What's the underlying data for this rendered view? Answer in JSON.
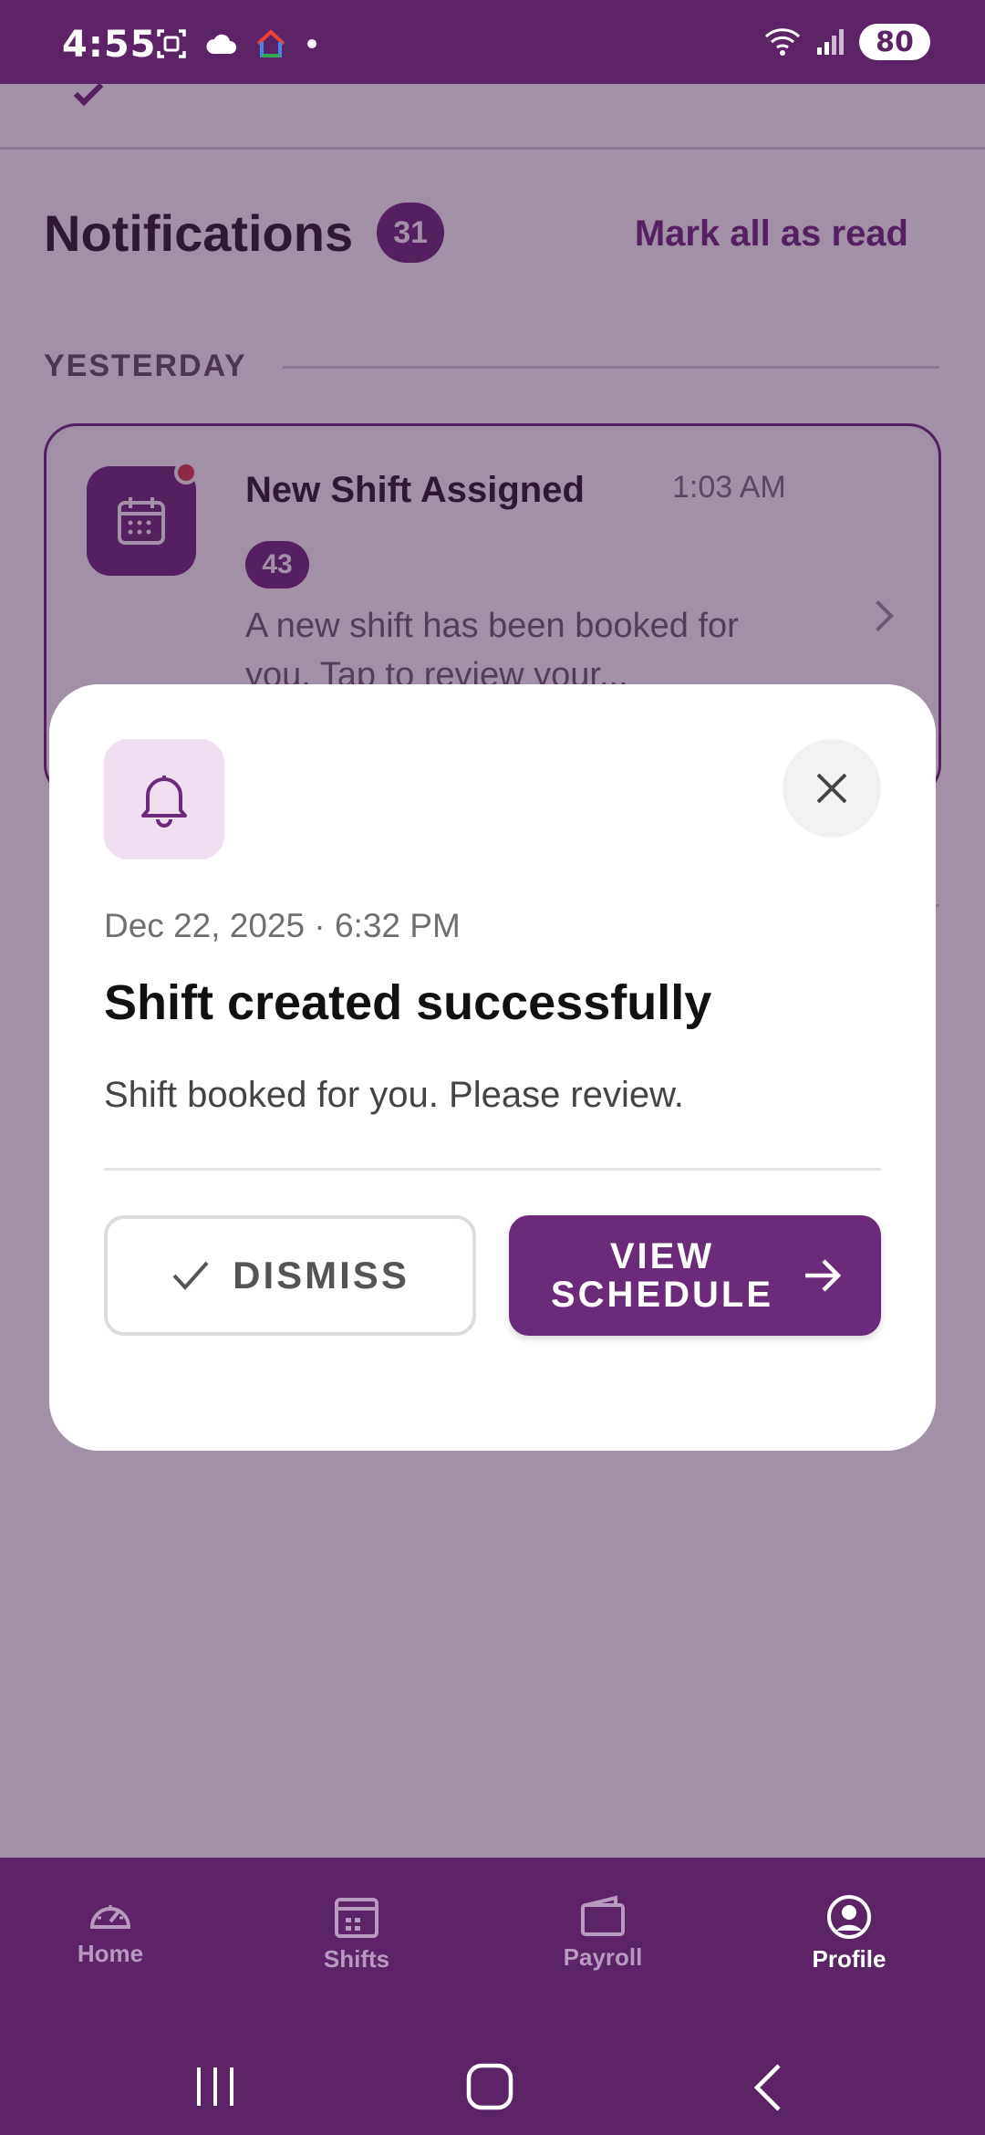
{
  "status_bar": {
    "time": "4:55",
    "battery": "80",
    "icons": [
      "screenshot-icon",
      "cloud-icon",
      "home-app-icon",
      "dot-icon",
      "wifi-icon",
      "signal-icon"
    ]
  },
  "header": {
    "title": "Notifications",
    "count": "31",
    "mark_all": "Mark all as read"
  },
  "sections": {
    "yesterday": "YESTERDAY"
  },
  "notification_card": {
    "title": "New Shift Assigned",
    "time": "1:03 AM",
    "badge": "43",
    "body": "A new shift has been booked for you. Tap to review your..."
  },
  "modal": {
    "date": "Dec 22, 2025 · 6:32 PM",
    "title": "Shift created successfully",
    "body": "Shift booked for you. Please review.",
    "dismiss_label": "DISMISS",
    "view_label": "VIEW SCHEDULE"
  },
  "bottom_nav": {
    "items": [
      {
        "label": "Home",
        "icon": "gauge-icon",
        "active": false
      },
      {
        "label": "Shifts",
        "icon": "calendar-icon",
        "active": false
      },
      {
        "label": "Payroll",
        "icon": "wallet-icon",
        "active": false
      },
      {
        "label": "Profile",
        "icon": "profile-icon",
        "active": true
      }
    ]
  },
  "colors": {
    "brand": "#6b2a7a",
    "status_bar": "#5c2467",
    "alert_dot": "#d63a4a"
  }
}
